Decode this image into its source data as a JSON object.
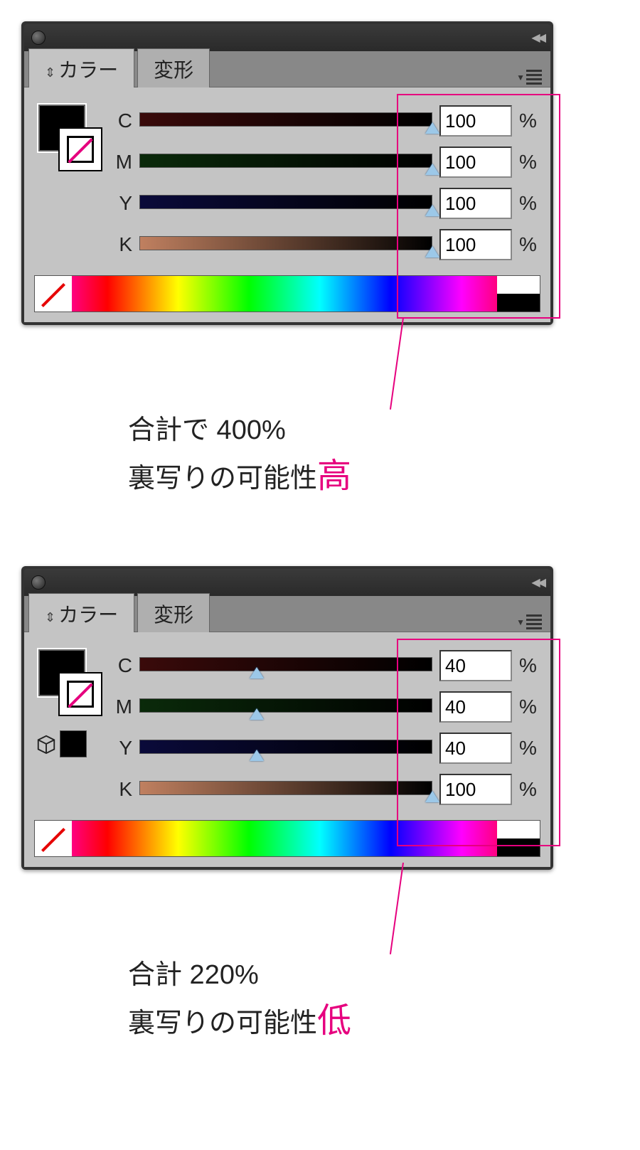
{
  "panel1": {
    "tabs": {
      "active": "カラー",
      "other": "変形"
    },
    "channels": [
      {
        "label": "C",
        "value": "100",
        "unit": "%",
        "handle_pct": 100
      },
      {
        "label": "M",
        "value": "100",
        "unit": "%",
        "handle_pct": 100
      },
      {
        "label": "Y",
        "value": "100",
        "unit": "%",
        "handle_pct": 100
      },
      {
        "label": "K",
        "value": "100",
        "unit": "%",
        "handle_pct": 100
      }
    ],
    "shows_3d_icon": false
  },
  "caption1": {
    "line1": "合計で 400%",
    "line2_prefix": "裏写りの可能性",
    "line2_accent": "高"
  },
  "panel2": {
    "tabs": {
      "active": "カラー",
      "other": "変形"
    },
    "channels": [
      {
        "label": "C",
        "value": "40",
        "unit": "%",
        "handle_pct": 40
      },
      {
        "label": "M",
        "value": "40",
        "unit": "%",
        "handle_pct": 40
      },
      {
        "label": "Y",
        "value": "40",
        "unit": "%",
        "handle_pct": 40
      },
      {
        "label": "K",
        "value": "100",
        "unit": "%",
        "handle_pct": 100
      }
    ],
    "shows_3d_icon": true
  },
  "caption2": {
    "line1": "合計 220%",
    "line2_prefix": "裏写りの可能性",
    "line2_accent": "低"
  },
  "track_gradients": {
    "C": [
      "#ffffff",
      "#00aeef"
    ],
    "M": [
      "#ffffff",
      "#ec008c"
    ],
    "Y": [
      "#ffffff",
      "#fff200"
    ],
    "K": [
      "#ffffff",
      "#000000"
    ],
    "C_full": [
      "#3a0a0a",
      "#000000"
    ],
    "M_full": [
      "#0a2a0a",
      "#000000"
    ],
    "Y_full": [
      "#0a0a3a",
      "#000000"
    ],
    "K_full": [
      "#c08060",
      "#000000"
    ]
  }
}
